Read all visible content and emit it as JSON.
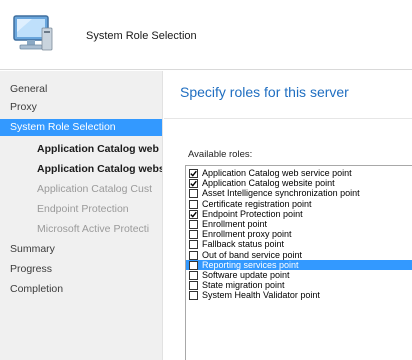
{
  "header": {
    "title": "System Role Selection",
    "icon": "computer-icon"
  },
  "sidebar": {
    "items": [
      {
        "label": "General",
        "level": "top",
        "selected": false
      },
      {
        "label": "Proxy",
        "level": "top",
        "selected": false
      },
      {
        "label": "System Role Selection",
        "level": "top",
        "selected": true
      },
      {
        "label": "Application Catalog web",
        "level": "sub",
        "strong": true
      },
      {
        "label": "Application Catalog webs",
        "level": "sub",
        "strong": true
      },
      {
        "label": "Application Catalog Cust",
        "level": "sub",
        "strong": false
      },
      {
        "label": "Endpoint Protection",
        "level": "sub",
        "strong": false
      },
      {
        "label": "Microsoft Active Protecti",
        "level": "sub",
        "strong": false
      },
      {
        "label": "Summary",
        "level": "top",
        "selected": false
      },
      {
        "label": "Progress",
        "level": "top",
        "selected": false
      },
      {
        "label": "Completion",
        "level": "top",
        "selected": false
      }
    ]
  },
  "main": {
    "heading": "Specify roles for this server",
    "available_label": "Available roles:",
    "roles": [
      {
        "label": "Application Catalog web service point",
        "checked": true,
        "highlighted": false
      },
      {
        "label": "Application Catalog website point",
        "checked": true,
        "highlighted": false
      },
      {
        "label": "Asset Intelligence synchronization point",
        "checked": false,
        "highlighted": false
      },
      {
        "label": "Certificate registration point",
        "checked": false,
        "highlighted": false
      },
      {
        "label": "Endpoint Protection point",
        "checked": true,
        "highlighted": false
      },
      {
        "label": "Enrollment point",
        "checked": false,
        "highlighted": false
      },
      {
        "label": "Enrollment proxy point",
        "checked": false,
        "highlighted": false
      },
      {
        "label": "Fallback status point",
        "checked": false,
        "highlighted": false
      },
      {
        "label": "Out of band service point",
        "checked": false,
        "highlighted": false
      },
      {
        "label": "Reporting services point",
        "checked": false,
        "highlighted": true
      },
      {
        "label": "Software update point",
        "checked": false,
        "highlighted": false
      },
      {
        "label": "State migration point",
        "checked": false,
        "highlighted": false
      },
      {
        "label": "System Health Validator point",
        "checked": false,
        "highlighted": false
      }
    ]
  },
  "colors": {
    "accent": "#3399ff",
    "heading": "#1f6ec1"
  }
}
